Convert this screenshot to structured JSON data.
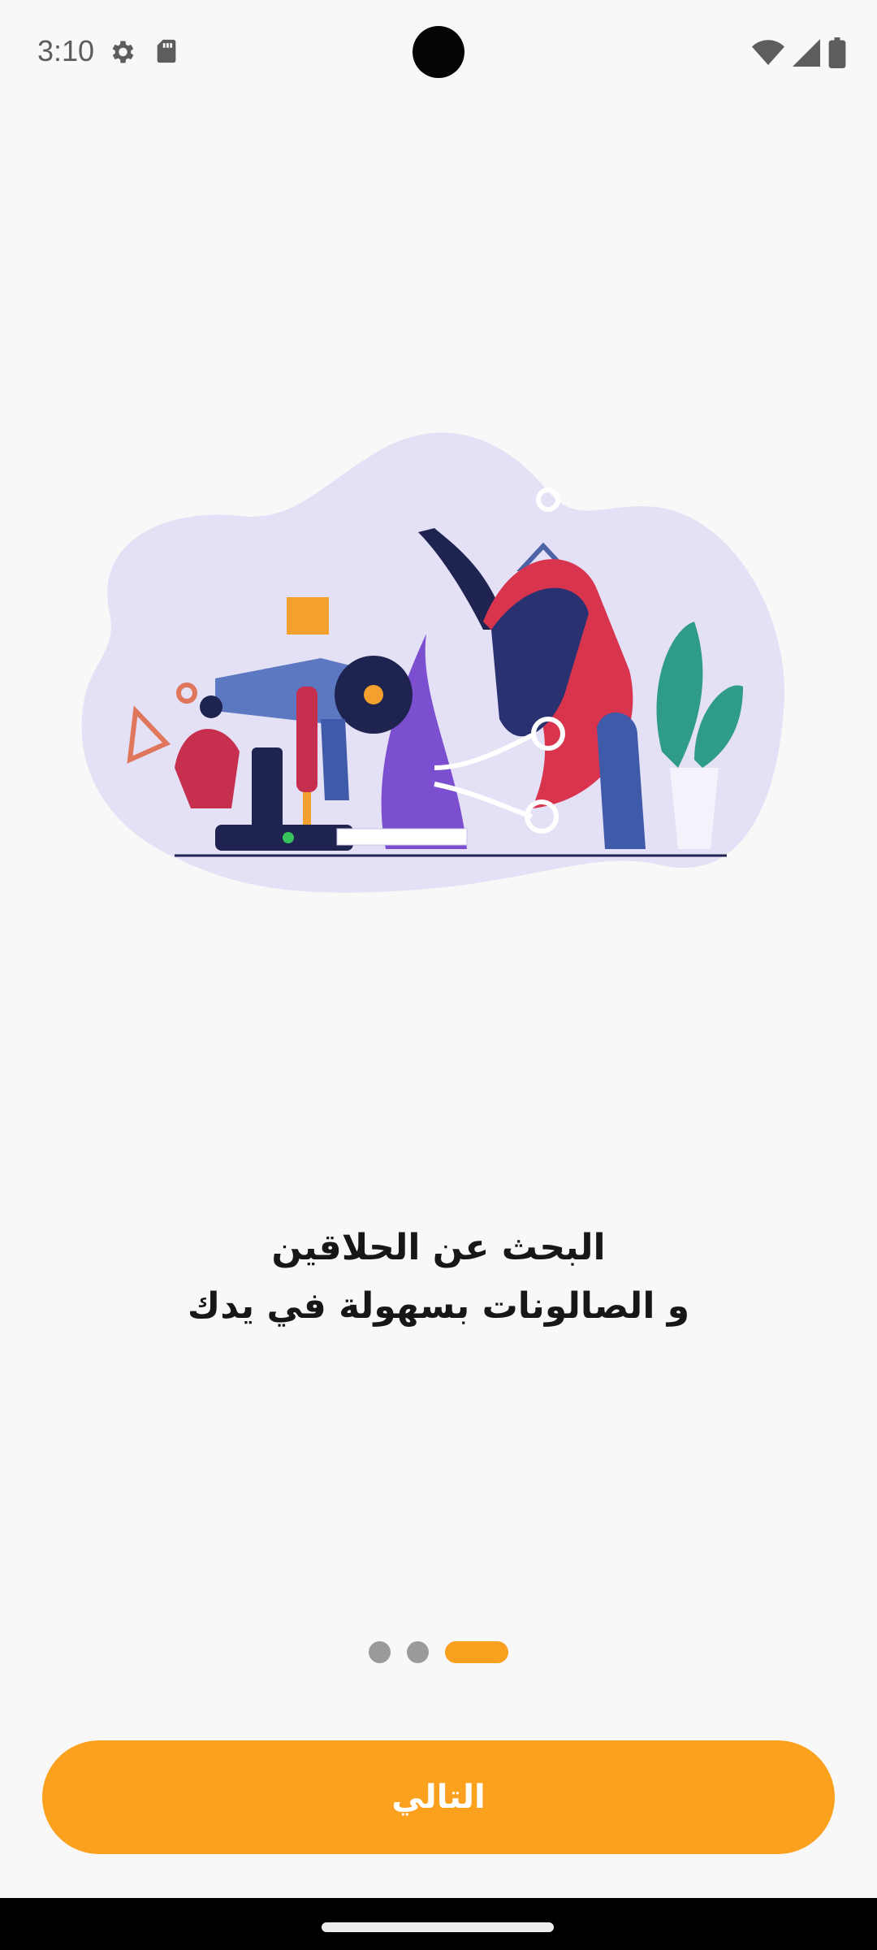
{
  "status_bar": {
    "time": "3:10",
    "left_icons": [
      "settings-icon",
      "sd-card-icon"
    ],
    "right_icons": [
      "wifi-icon",
      "signal-icon",
      "battery-icon"
    ]
  },
  "onboarding": {
    "illustration": "salon-tools-illustration",
    "headline_line1": "البحث عن الحلاقين",
    "headline_line2": "و الصالونات بسهولة في يدك",
    "page_count": 3,
    "active_page": 3
  },
  "actions": {
    "next_label": "التالي"
  },
  "colors": {
    "accent": "#fba11e",
    "inactive_dot": "#9a9a9a",
    "background": "#f8f8f8",
    "text": "#171717"
  }
}
